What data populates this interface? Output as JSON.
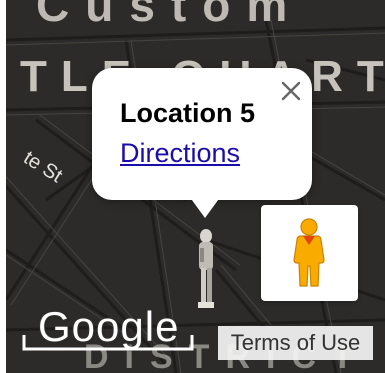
{
  "map": {
    "area_label_top": "Custom",
    "area_label_quarter": "TLE QUARTER",
    "area_label_bottom": "DISTRICT",
    "street_label": "te St"
  },
  "info_window": {
    "title": "Location 5",
    "directions_link": "Directions",
    "close_glyph": "×"
  },
  "controls": {
    "pegman_icon": "pegman-icon",
    "pegman_color": "#f9ab00",
    "terms_label": "Terms of Use"
  },
  "branding": {
    "logo_text": "Google"
  },
  "colors": {
    "map_background": "#2c2b29",
    "link": "#1a0dab",
    "pegman": "#f9ab00"
  }
}
